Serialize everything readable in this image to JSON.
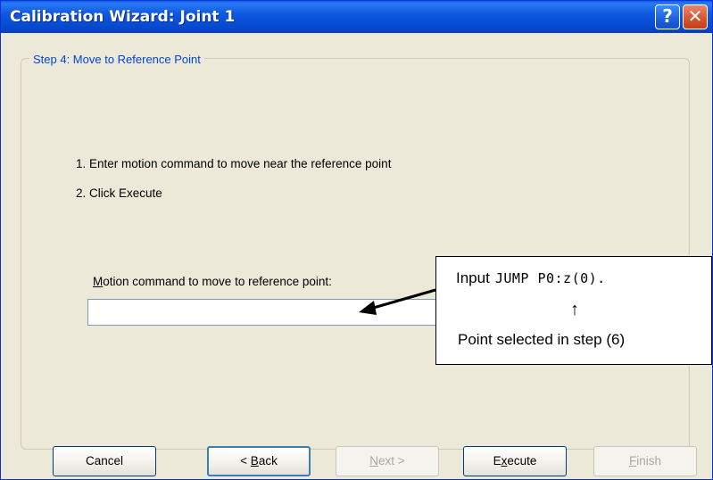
{
  "window": {
    "title": "Calibration Wizard: Joint 1",
    "help_glyph": "?",
    "close_glyph": "✕"
  },
  "step": {
    "legend": "Step 4: Move to Reference Point",
    "instruction_1": "1. Enter motion command to move near the reference point",
    "instruction_2": "2. Click Execute"
  },
  "motion": {
    "label_accel": "M",
    "label_rest": "otion command to move to reference point:",
    "value": ""
  },
  "callout": {
    "prefix": "Input",
    "code": "JUMP P0:z(0).",
    "arrow": "↑",
    "note": "Point selected in step (6)"
  },
  "buttons": {
    "cancel": "Cancel",
    "back_prefix": "< ",
    "back_accel": "B",
    "back_rest": "ack",
    "next_accel": "N",
    "next_rest": "ext >",
    "execute_pre": "E",
    "execute_accel": "x",
    "execute_rest": "ecute",
    "finish_accel": "F",
    "finish_rest": "inish"
  },
  "colors": {
    "titlebar": "#0a5fe6",
    "legend_text": "#0046d5",
    "dialog_bg": "#ece9d8"
  }
}
